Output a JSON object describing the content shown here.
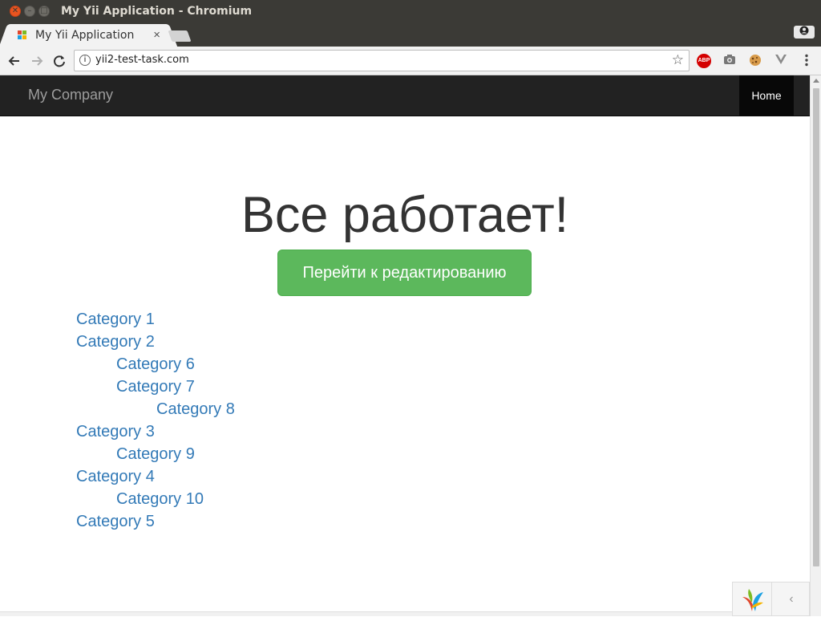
{
  "window": {
    "title": "My Yii Application - Chromium"
  },
  "tab": {
    "title": "My Yii Application",
    "close_glyph": "×"
  },
  "toolbar": {
    "url": "yii2-test-task.com",
    "info_glyph": "i",
    "abp_label": "ABP"
  },
  "navbar": {
    "brand": "My Company",
    "home": "Home"
  },
  "main": {
    "heading": "Все работает!",
    "edit_button": "Перейти к редактированию",
    "categories": [
      {
        "label": "Category 1",
        "level": 0
      },
      {
        "label": "Category 2",
        "level": 0
      },
      {
        "label": "Category 6",
        "level": 1
      },
      {
        "label": "Category 7",
        "level": 1
      },
      {
        "label": "Category 8",
        "level": 2
      },
      {
        "label": "Category 3",
        "level": 0
      },
      {
        "label": "Category 9",
        "level": 1
      },
      {
        "label": "Category 4",
        "level": 0
      },
      {
        "label": "Category 10",
        "level": 1
      },
      {
        "label": "Category 5",
        "level": 0
      }
    ]
  },
  "colors": {
    "link": "#337ab7",
    "button": "#5cb85c",
    "navbar": "#222222",
    "ubuntu_close": "#e95420"
  },
  "icons": [
    "close-icon",
    "minimize-icon",
    "maximize-icon",
    "back-arrow-icon",
    "forward-arrow-icon",
    "reload-icon",
    "info-icon",
    "star-icon",
    "adblock-icon",
    "camera-icon",
    "cookie-icon",
    "vue-devtools-icon",
    "menu-dots-icon",
    "profile-icon",
    "yii-logo-icon",
    "chevron-left-icon"
  ]
}
